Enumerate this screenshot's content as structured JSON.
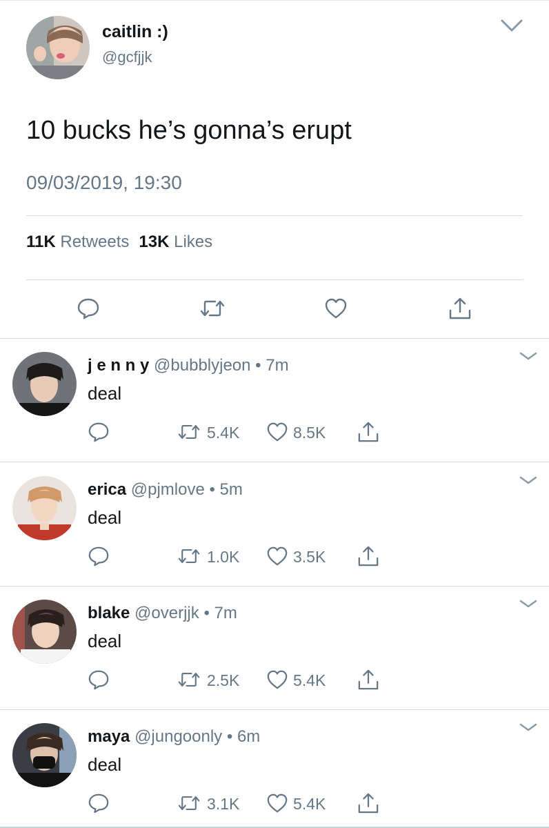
{
  "main_tweet": {
    "name": "caitlin :)",
    "handle": "@gcfjjk",
    "text": "10 bucks he’s gonna’s erupt",
    "datetime": "09/03/2019, 19:30",
    "retweets_count": "11K",
    "retweets_label": "Retweets",
    "likes_count": "13K",
    "likes_label": "Likes"
  },
  "replies": [
    {
      "name": "j e n n y",
      "handle": "@bubblyjeon",
      "time": "7m",
      "text": "deal",
      "retweets": "5.4K",
      "likes": "8.5K"
    },
    {
      "name": "erica",
      "handle": "@pjmlove",
      "time": "5m",
      "text": "deal",
      "retweets": "1.0K",
      "likes": "3.5K"
    },
    {
      "name": "blake",
      "handle": "@overjjk",
      "time": "7m",
      "text": "deal",
      "retweets": "2.5K",
      "likes": "5.4K"
    },
    {
      "name": "maya",
      "handle": "@jungoonly",
      "time": "6m",
      "text": "deal",
      "retweets": "3.1K",
      "likes": "5.4K"
    }
  ],
  "separator": "•",
  "icons": [
    "chevron-down-icon",
    "reply-icon",
    "retweet-icon",
    "like-icon",
    "share-icon"
  ],
  "colors": {
    "text": "#14171a",
    "secondary": "#657786",
    "divider": "#d8dde1",
    "background": "#ffffff"
  }
}
